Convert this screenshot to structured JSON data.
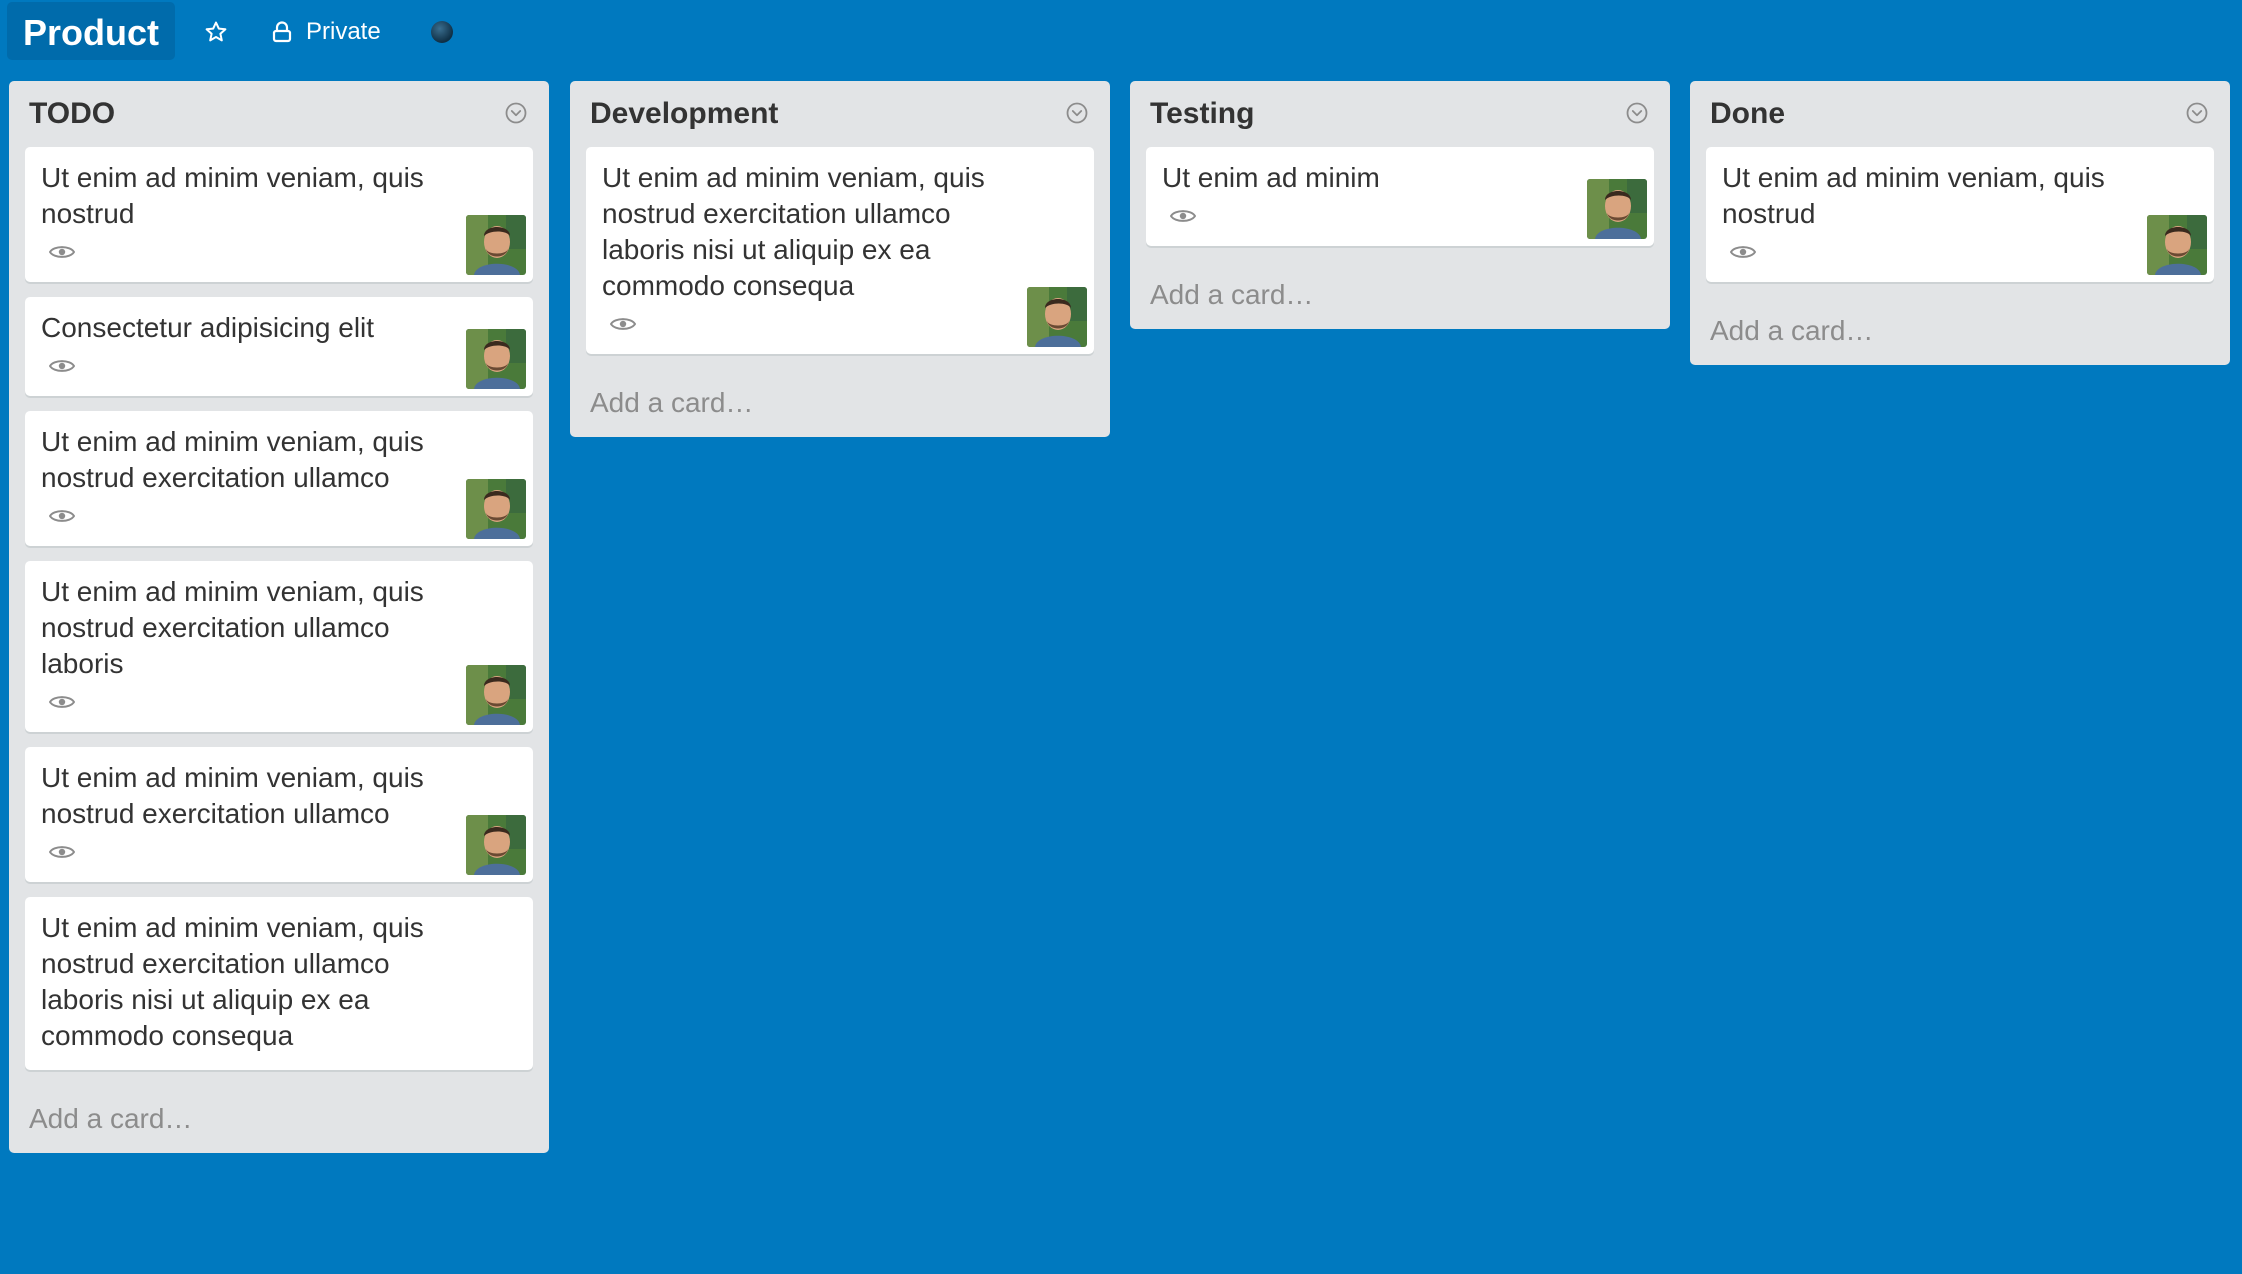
{
  "board": {
    "title": "Product",
    "visibility_label": "Private",
    "icons": {
      "star": "star-icon",
      "lock": "lock-icon",
      "org": "organization-icon"
    },
    "colors": {
      "background": "#0079bf",
      "title_bg": "#006bab",
      "list_bg": "#e2e4e6",
      "card_bg": "#ffffff",
      "text": "#333333",
      "muted": "#8c8c8c"
    }
  },
  "lists": [
    {
      "title": "TODO",
      "add_card_label": "Add a card…",
      "cards": [
        {
          "text": "Ut enim ad minim veniam, quis nostrud"
        },
        {
          "text": "Consectetur adipisicing elit"
        },
        {
          "text": "Ut enim ad minim veniam, quis nostrud exercitation ullamco"
        },
        {
          "text": "Ut enim ad minim veniam, quis nostrud exercitation ullamco laboris"
        },
        {
          "text": "Ut enim ad minim veniam, quis nostrud exercitation ullamco"
        },
        {
          "text": "Ut enim ad minim veniam, quis nostrud exercitation ullamco laboris nisi ut aliquip ex ea commodo consequa"
        }
      ]
    },
    {
      "title": "Development",
      "add_card_label": "Add a card…",
      "cards": [
        {
          "text": "Ut enim ad minim veniam, quis nostrud exercitation ullamco laboris nisi ut aliquip ex ea commodo consequa"
        }
      ]
    },
    {
      "title": "Testing",
      "add_card_label": "Add a card…",
      "cards": [
        {
          "text": "Ut enim ad minim"
        }
      ]
    },
    {
      "title": "Done",
      "add_card_label": "Add a card…",
      "cards": [
        {
          "text": "Ut enim ad minim veniam, quis nostrud"
        }
      ]
    }
  ]
}
